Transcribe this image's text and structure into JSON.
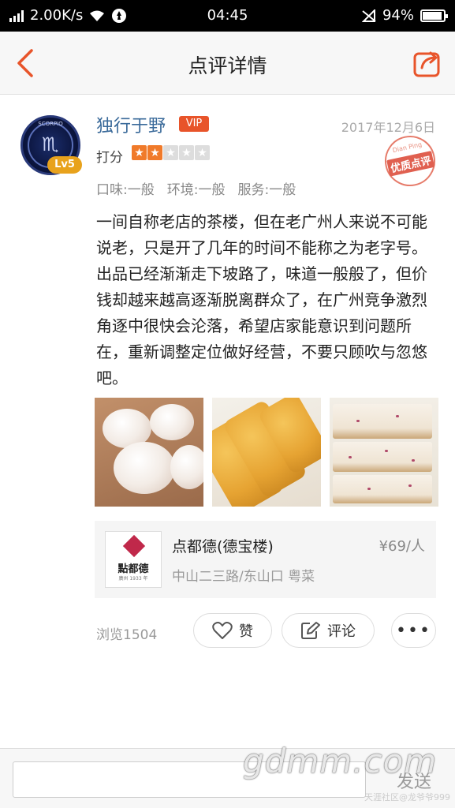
{
  "status_bar": {
    "speed": "2.00K/s",
    "time": "04:45",
    "battery": "94%"
  },
  "nav": {
    "title": "点评详情"
  },
  "review": {
    "user": {
      "name": "独行于野",
      "vip": "VIP",
      "level": "Lv5",
      "avatar_text": "SCORPIO"
    },
    "date": "2017年12月6日",
    "score_label": "打分",
    "rating": 2,
    "rating_max": 5,
    "stamp": {
      "small": "Dian Ping",
      "main": "优质点评"
    },
    "sub_scores": [
      "口味:一般",
      "环境:一般",
      "服务:一般"
    ],
    "text": "一间自称老店的茶楼，但在老广州人来说不可能说老，只是开了几年的时间不能称之为老字号。出品已经渐渐走下坡路了，味道一般般了，但价钱却越来越高逐渐脱离群众了，在广州竞争激烈角逐中很快会沦落，希望店家能意识到问题所在，重新调整定位做好经营，不要只顾吹与忽悠吧。"
  },
  "shop": {
    "logo_text": "點都德",
    "logo_sub": "廣州 1933 年",
    "name": "点都德(德宝楼)",
    "price": "¥69/人",
    "address": "中山二三路/东山口 粤菜"
  },
  "actions": {
    "views": "浏览1504",
    "like": "赞",
    "comment": "评论",
    "more": "•••"
  },
  "bottom": {
    "send": "发送"
  },
  "watermark": {
    "main": "gdmm.com",
    "sub": "天涯社区@龙爷爷999"
  },
  "colors": {
    "accent": "#e8542a",
    "star_on": "#f07a2a",
    "username": "#3a6a9a"
  }
}
